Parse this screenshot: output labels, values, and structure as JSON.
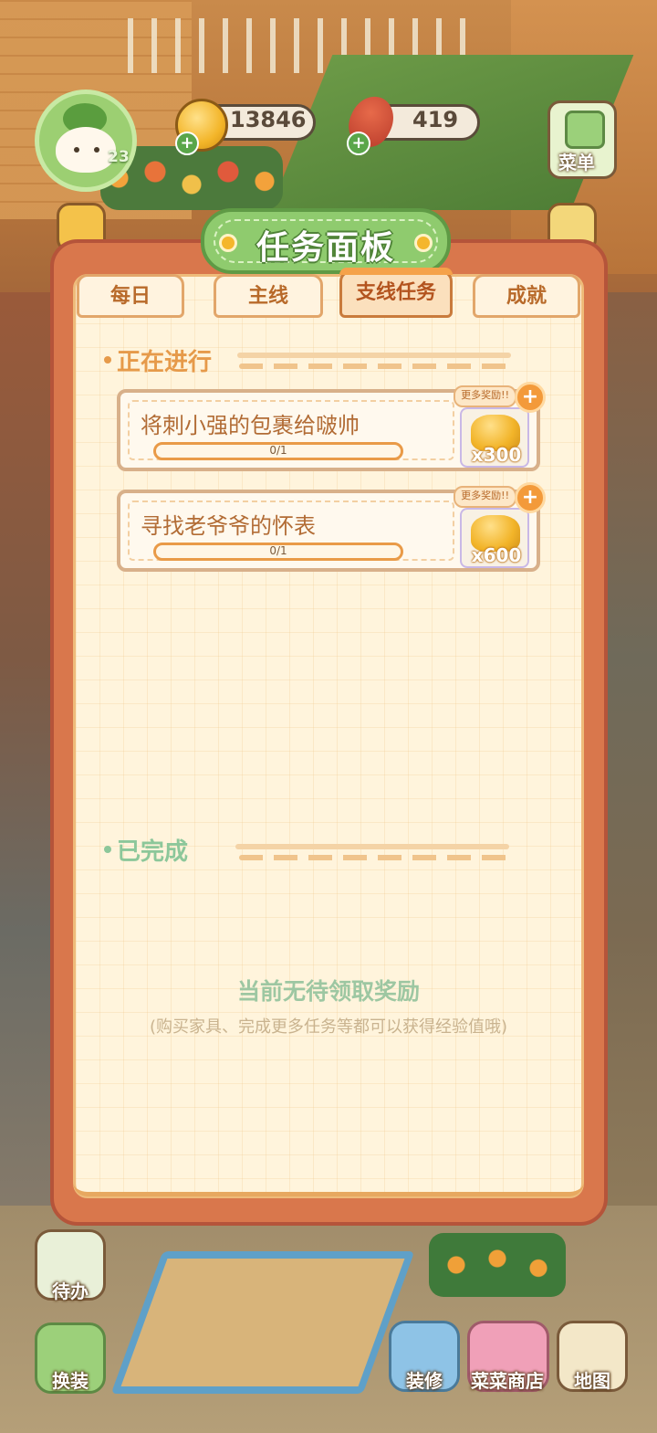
{
  "hud": {
    "level": "23",
    "coins": "13846",
    "food": "419",
    "menu_label": "菜单"
  },
  "panel": {
    "title": "任务面板",
    "tabs": [
      {
        "label": "每日",
        "active": false
      },
      {
        "label": "主线",
        "active": false
      },
      {
        "label": "支线任务",
        "active": true
      },
      {
        "label": "成就",
        "active": false
      }
    ],
    "in_progress_title": "正在进行",
    "completed_title": "已完成",
    "tasks": [
      {
        "name": "将刺小强的包裹给啵帅",
        "progress_text": "0/1",
        "progress": 0,
        "more_label": "更多奖励!!",
        "reward": "x300"
      },
      {
        "name": "寻找老爷爷的怀表",
        "progress_text": "0/1",
        "progress": 0,
        "more_label": "更多奖励!!",
        "reward": "x600"
      }
    ],
    "empty_title": "当前无待领取奖励",
    "empty_subtitle": "(购买家具、完成更多任务等都可以获得经验值哦)"
  },
  "bottom": {
    "todo": "待办",
    "dressup": "换装",
    "decorate": "装修",
    "shop": "菜菜商店",
    "map": "地图"
  },
  "colors": {
    "panel_border": "#d9774c",
    "paper": "#fff4dc",
    "title_green": "#8fcb6e",
    "section_orange": "#e69a4a",
    "section_green": "#8cc79a"
  }
}
